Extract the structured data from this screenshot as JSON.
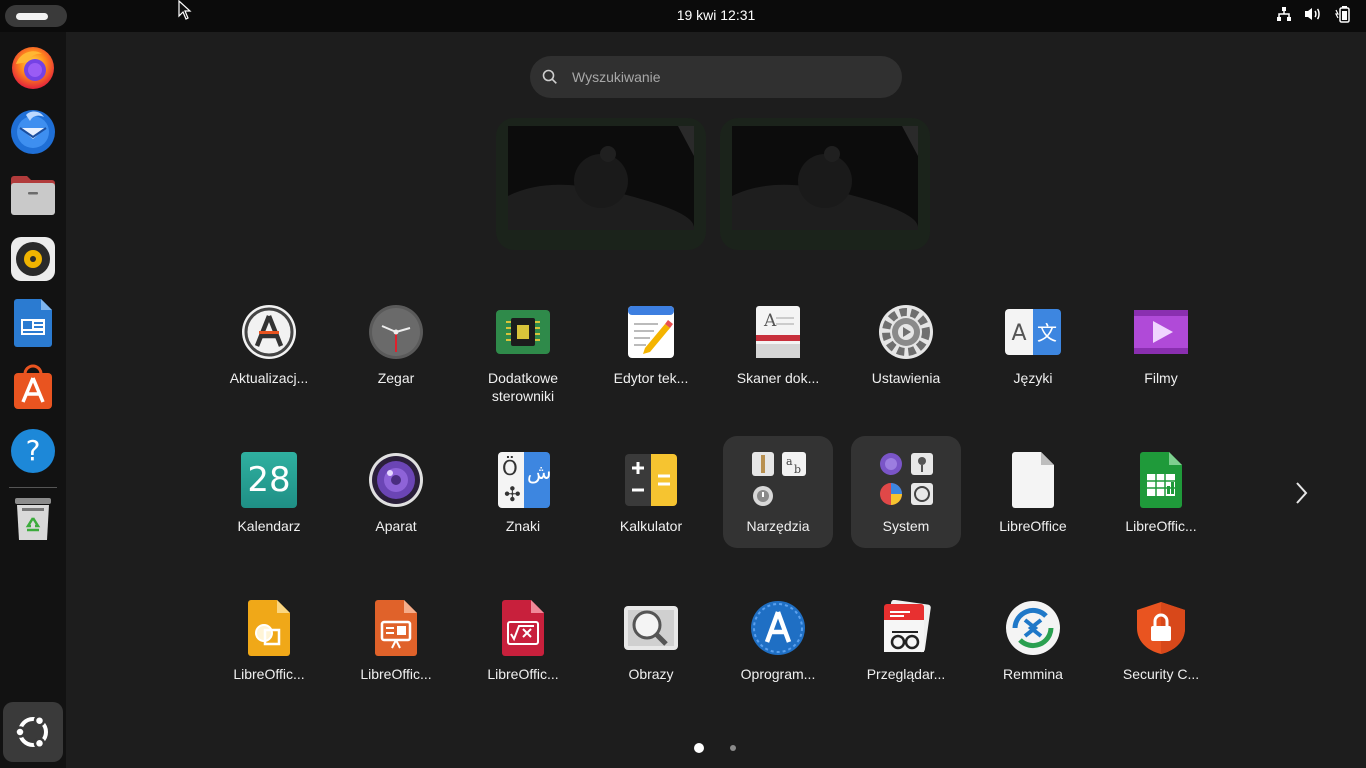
{
  "topbar": {
    "clock": "19 kwi  12:31",
    "indicators": [
      "network-icon",
      "volume-icon",
      "battery-icon"
    ]
  },
  "dock": {
    "items": [
      {
        "name": "firefox-icon"
      },
      {
        "name": "thunderbird-icon"
      },
      {
        "name": "files-icon"
      },
      {
        "name": "rhythmbox-icon"
      },
      {
        "name": "libreoffice-writer-icon"
      },
      {
        "name": "app-center-icon"
      },
      {
        "name": "help-icon"
      },
      {
        "name": "trash-icon"
      }
    ],
    "show_apps": "ubuntu-logo-icon"
  },
  "search": {
    "placeholder": "Wyszukiwanie"
  },
  "apps": [
    {
      "label": "Aktualizacj...",
      "icon": "software-updater-icon"
    },
    {
      "label": "Zegar",
      "icon": "clock-icon"
    },
    {
      "label": "Dodatkowe sterowniki",
      "icon": "chip-icon"
    },
    {
      "label": "Edytor tek...",
      "icon": "text-editor-icon"
    },
    {
      "label": "Skaner dok...",
      "icon": "scanner-icon"
    },
    {
      "label": "Ustawienia",
      "icon": "settings-icon"
    },
    {
      "label": "Języki",
      "icon": "language-icon"
    },
    {
      "label": "Filmy",
      "icon": "videos-icon"
    },
    {
      "label": "Kalendarz",
      "icon": "calendar-icon",
      "day": "28"
    },
    {
      "label": "Aparat",
      "icon": "camera-icon"
    },
    {
      "label": "Znaki",
      "icon": "characters-icon",
      "glyph1": "Ö",
      "glyph2": "ش"
    },
    {
      "label": "Kalkulator",
      "icon": "calculator-icon"
    },
    {
      "label": "Narzędzia",
      "icon": "folder-icon"
    },
    {
      "label": "System",
      "icon": "folder-icon"
    },
    {
      "label": "LibreOffice",
      "icon": "libreoffice-icon"
    },
    {
      "label": "LibreOffic...",
      "icon": "libreoffice-calc-icon"
    },
    {
      "label": "LibreOffic...",
      "icon": "libreoffice-draw-icon"
    },
    {
      "label": "LibreOffic...",
      "icon": "libreoffice-impress-icon"
    },
    {
      "label": "LibreOffic...",
      "icon": "libreoffice-math-icon"
    },
    {
      "label": "Obrazy",
      "icon": "image-viewer-icon"
    },
    {
      "label": "Oprogram...",
      "icon": "software-icon"
    },
    {
      "label": "Przeglądar...",
      "icon": "document-viewer-icon"
    },
    {
      "label": "Remmina",
      "icon": "remmina-icon"
    },
    {
      "label": "Security C...",
      "icon": "security-center-icon"
    }
  ],
  "pagination": {
    "pages": 2,
    "current": 1
  },
  "colors": {
    "background": "#1d1d1d",
    "topbar": "#0b0b0b",
    "dock": "#121212",
    "folder_tile": "#333333",
    "accent": "#e95420"
  }
}
